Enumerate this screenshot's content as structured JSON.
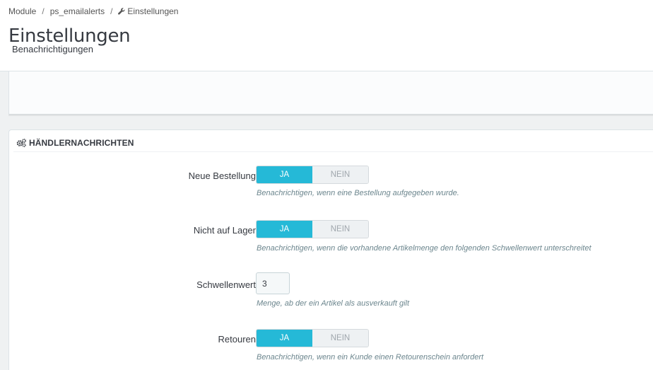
{
  "breadcrumb": {
    "items": [
      "Module",
      "ps_emailalerts",
      "Einstellungen"
    ],
    "separator": "/"
  },
  "header": {
    "title": "Einstellungen",
    "subtitle": "Benachrichtigungen"
  },
  "panel": {
    "title": "HÄNDLERNACHRICHTEN",
    "icon": "cogs-icon"
  },
  "fields": {
    "new_order": {
      "label": "Neue Bestellung",
      "yes": "JA",
      "no": "NEIN",
      "value": "yes",
      "help": "Benachrichtigen, wenn eine Bestellung aufgegeben wurde."
    },
    "out_of_stock": {
      "label": "Nicht auf Lager",
      "yes": "JA",
      "no": "NEIN",
      "value": "yes",
      "help": "Benachrichtigen, wenn die vorhandene Artikelmenge den folgenden Schwellenwert unterschreitet"
    },
    "threshold": {
      "label": "Schwellenwert",
      "value": "3",
      "help": "Menge, ab der ein Artikel als ausverkauft gilt"
    },
    "returns": {
      "label": "Retouren",
      "yes": "JA",
      "no": "NEIN",
      "value": "yes",
      "help": "Benachrichtigen, wenn ein Kunde einen Retourenschein anfordert"
    }
  },
  "colors": {
    "accent": "#25b9d7",
    "background": "#eff1f2",
    "help_text": "#6c868e"
  }
}
